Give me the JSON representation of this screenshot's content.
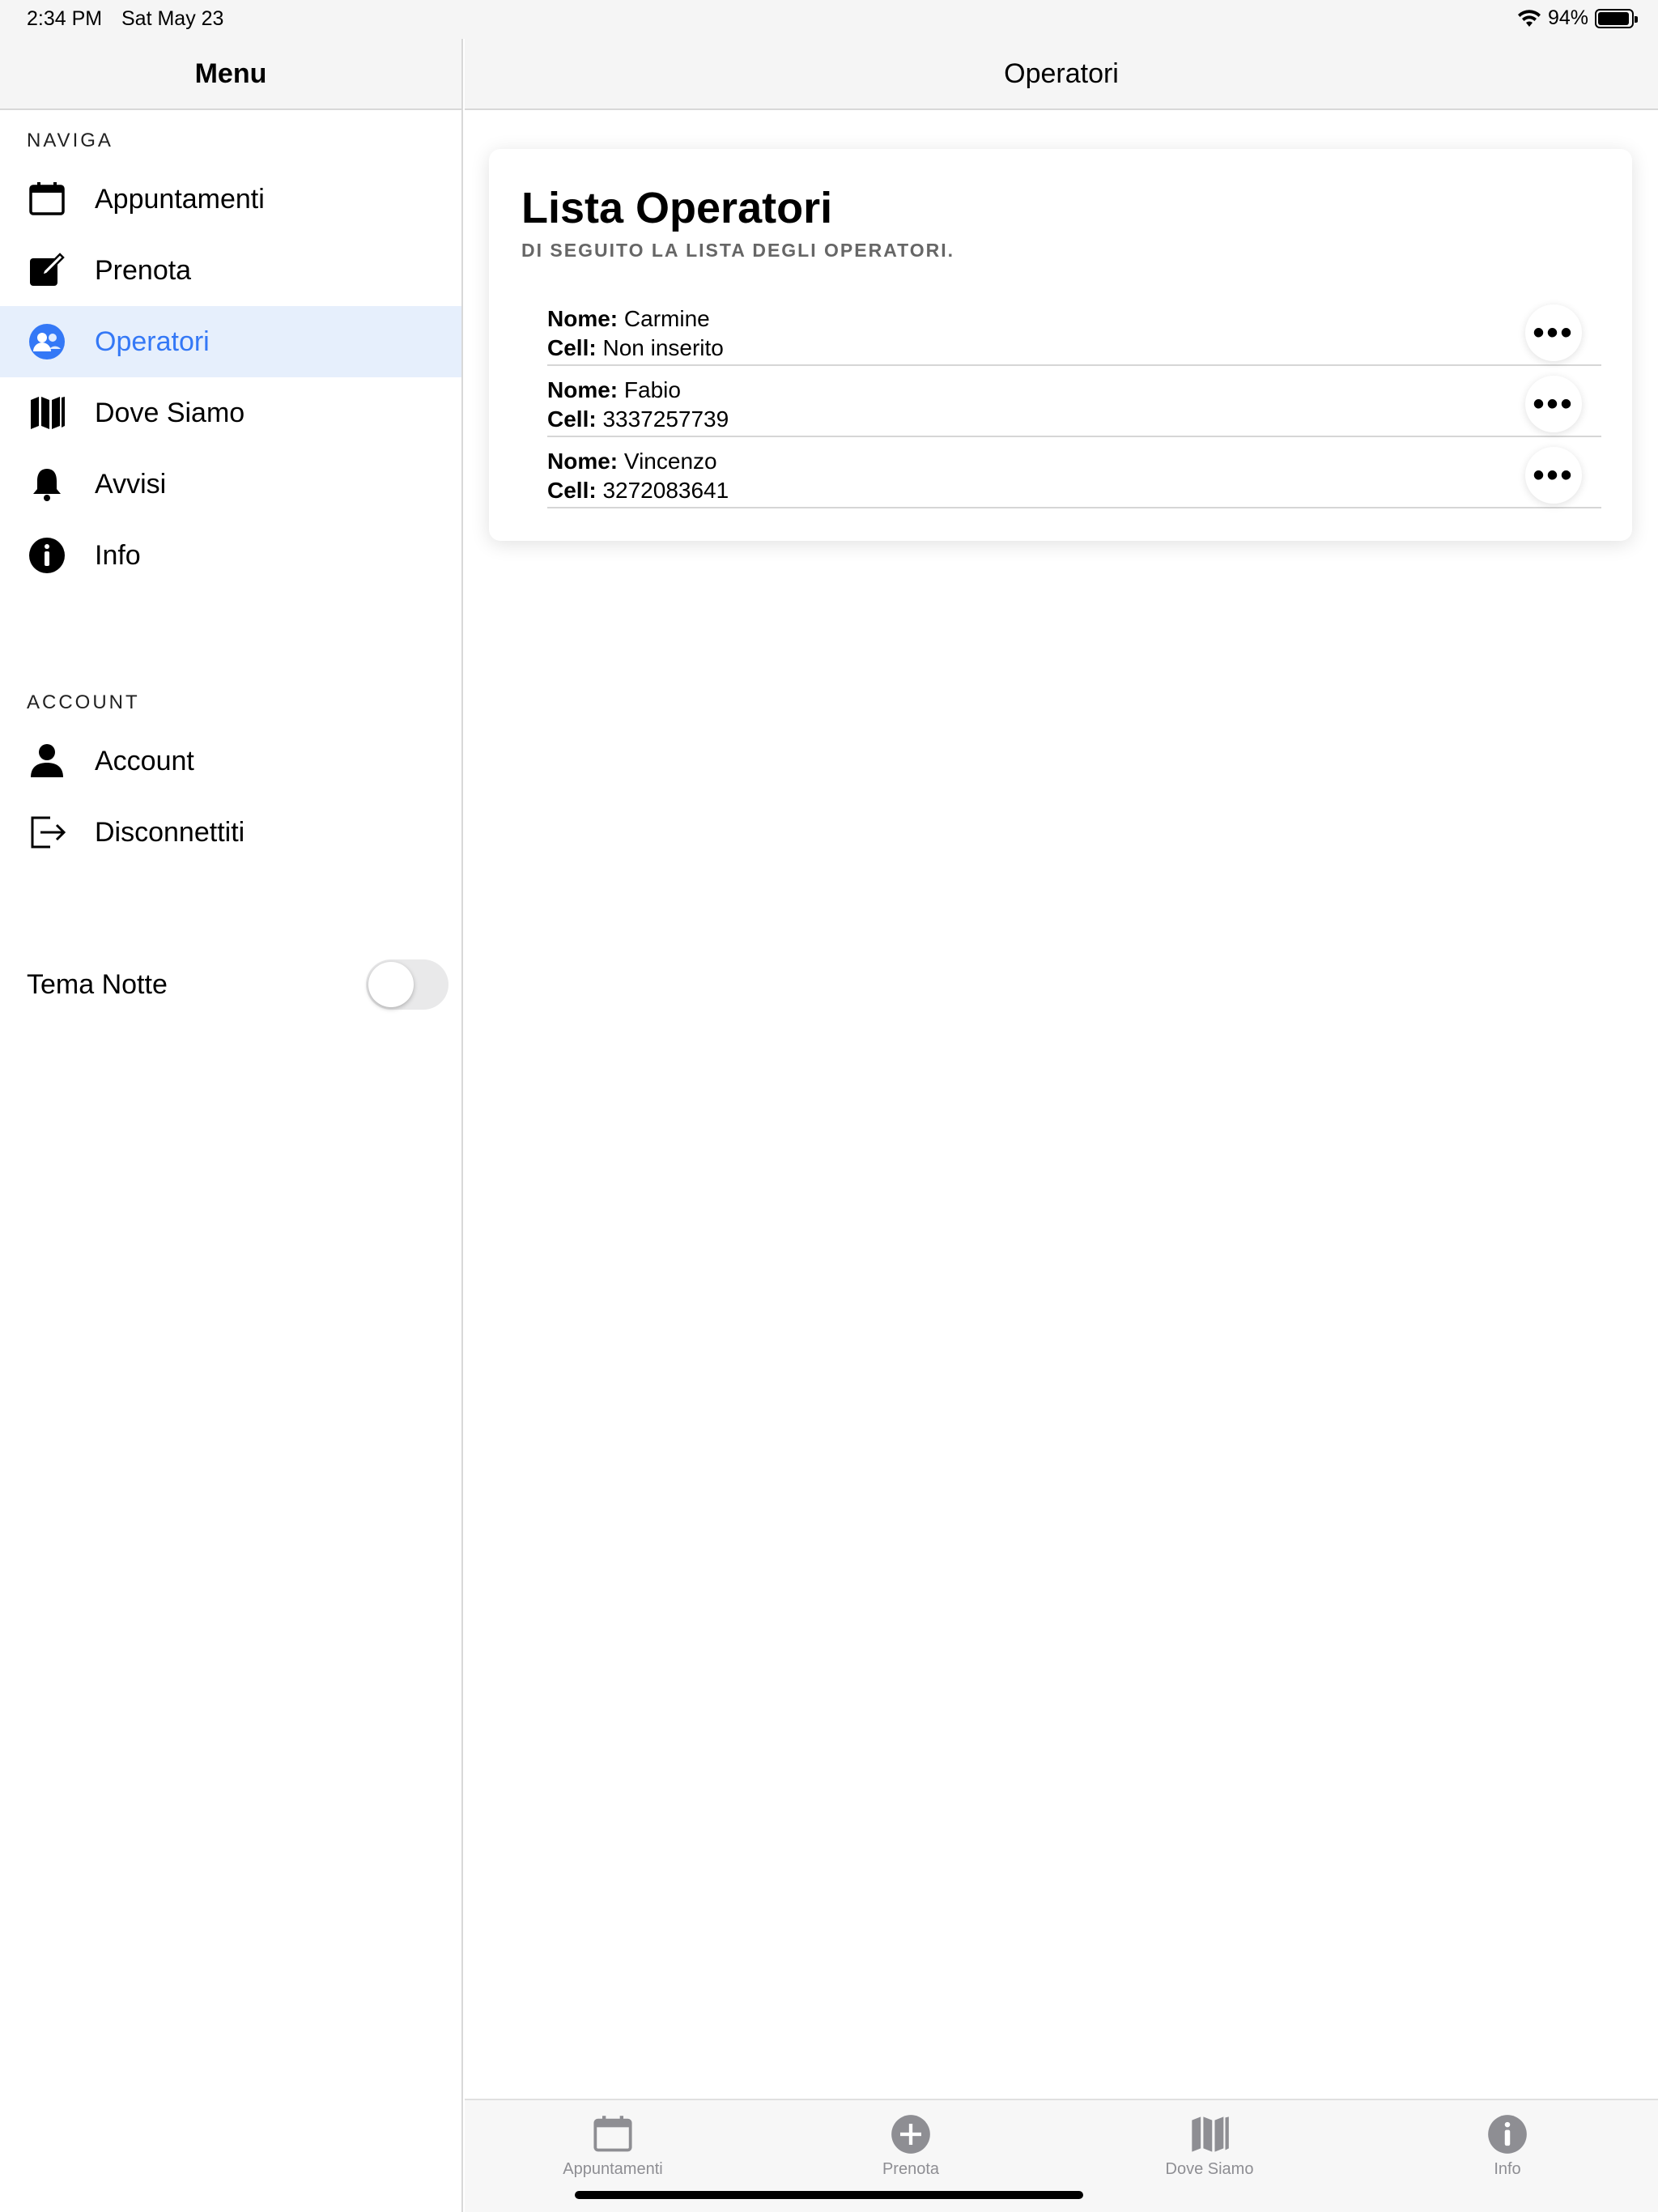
{
  "status_bar": {
    "time": "2:34 PM",
    "date": "Sat May 23",
    "battery": "94%",
    "battery_level": 0.94
  },
  "sidebar": {
    "title": "Menu",
    "sections": {
      "naviga": "NAVIGA",
      "account": "ACCOUNT"
    },
    "nav_items": [
      {
        "label": "Appuntamenti",
        "icon": "calendar-icon"
      },
      {
        "label": "Prenota",
        "icon": "edit-icon"
      },
      {
        "label": "Operatori",
        "icon": "people-icon",
        "active": true
      },
      {
        "label": "Dove Siamo",
        "icon": "map-icon"
      },
      {
        "label": "Avvisi",
        "icon": "bell-icon"
      },
      {
        "label": "Info",
        "icon": "info-icon"
      }
    ],
    "account_items": [
      {
        "label": "Account",
        "icon": "user-icon"
      },
      {
        "label": "Disconnettiti",
        "icon": "logout-icon"
      }
    ],
    "night_theme": {
      "label": "Tema Notte",
      "enabled": false
    }
  },
  "main": {
    "title": "Operatori",
    "card": {
      "title": "Lista Operatori",
      "subtitle": "DI SEGUITO LA LISTA DEGLI OPERATORI.",
      "name_label": "Nome:",
      "cell_label": "Cell:",
      "more_label": "•••",
      "operators": [
        {
          "name": "Carmine",
          "cell": "Non inserito"
        },
        {
          "name": "Fabio",
          "cell": "3337257739"
        },
        {
          "name": "Vincenzo",
          "cell": "3272083641"
        }
      ]
    }
  },
  "tabbar": {
    "tabs": [
      {
        "label": "Appuntamenti",
        "icon": "calendar-icon"
      },
      {
        "label": "Prenota",
        "icon": "plus-circle-icon"
      },
      {
        "label": "Dove Siamo",
        "icon": "map-icon"
      },
      {
        "label": "Info",
        "icon": "info-icon"
      }
    ]
  },
  "colors": {
    "accent": "#3478f6",
    "active_bg": "#e6effc",
    "tab_inactive": "#8e8e93"
  }
}
